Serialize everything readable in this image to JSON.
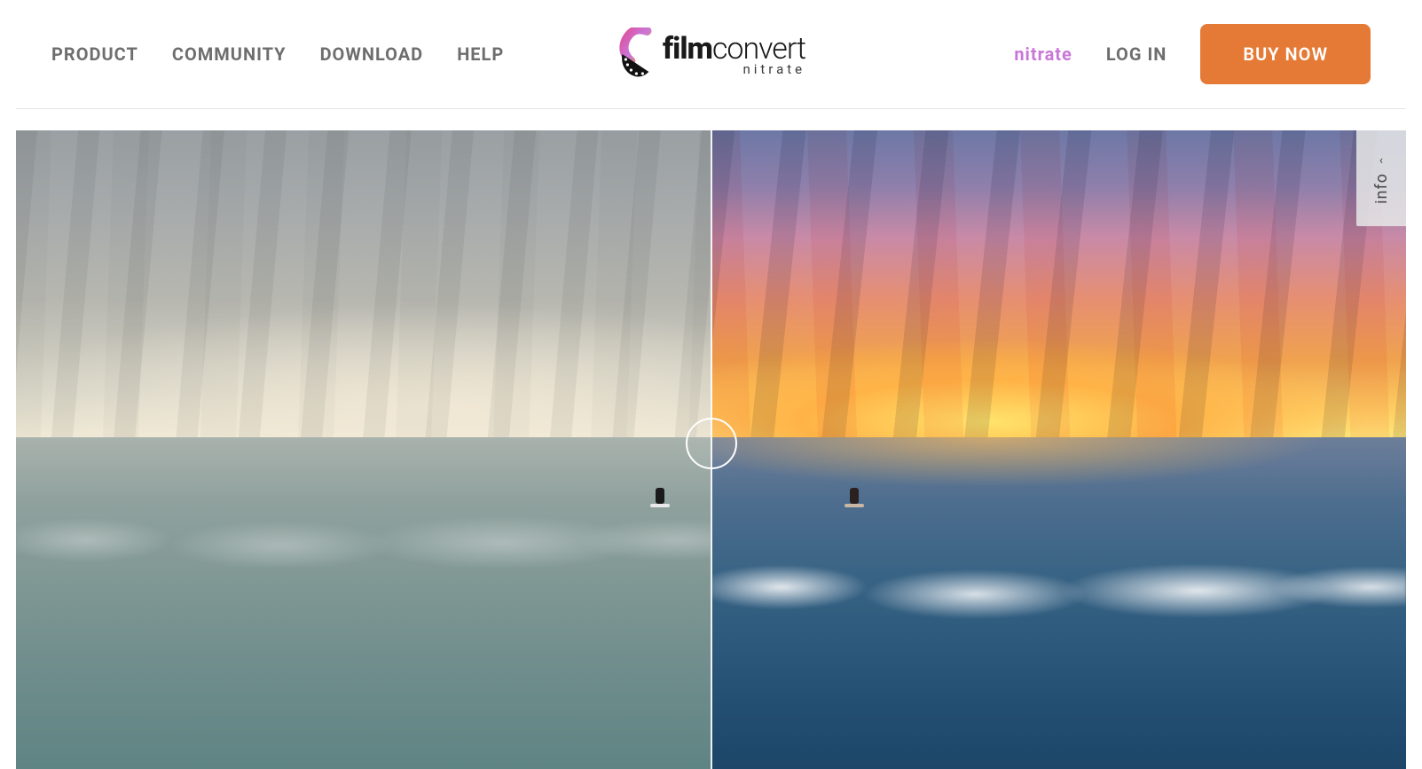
{
  "nav": {
    "left": [
      {
        "id": "product",
        "label": "PRODUCT"
      },
      {
        "id": "community",
        "label": "COMMUNITY"
      },
      {
        "id": "download",
        "label": "DOWNLOAD"
      },
      {
        "id": "help",
        "label": "HELP"
      }
    ],
    "right": [
      {
        "id": "nitrate",
        "label": "nitrate",
        "accent": true
      },
      {
        "id": "login",
        "label": "LOG IN"
      }
    ],
    "buy_label": "BUY NOW"
  },
  "logo": {
    "bold": "film",
    "light": "convert",
    "sub": "nitrate"
  },
  "hero": {
    "info_tab": "info",
    "slider_position_pct": 50
  },
  "colors": {
    "accent_orange": "#e57a37",
    "accent_magenta": "#c976d9",
    "nav_text": "#6e6e6e"
  }
}
